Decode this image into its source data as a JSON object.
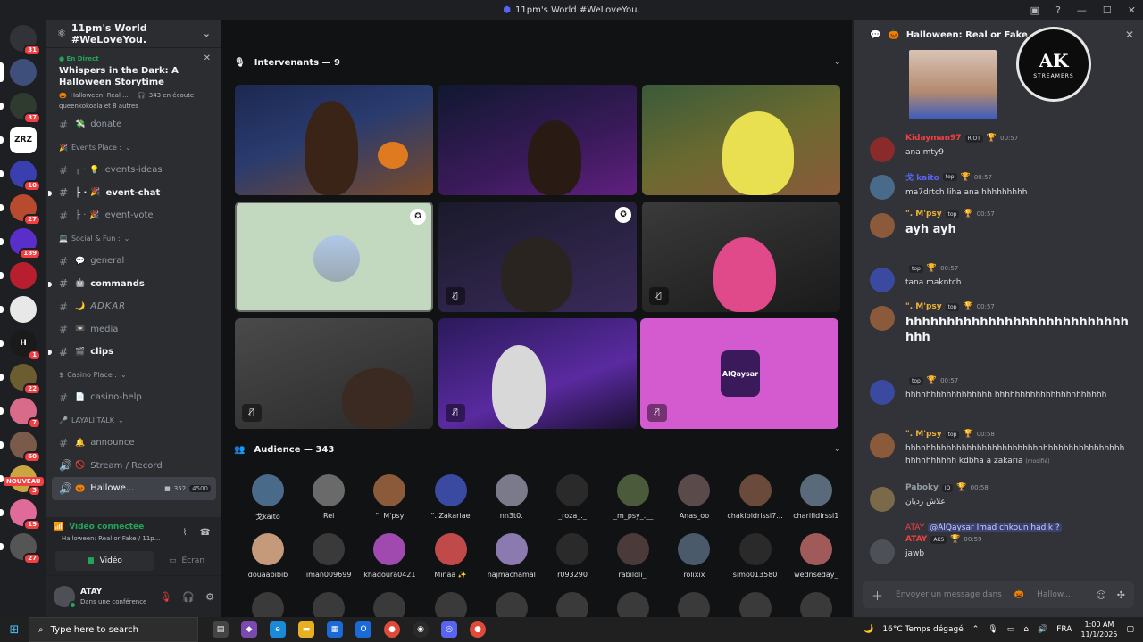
{
  "window": {
    "title": "11pm's World #WeLoveYou."
  },
  "colors": {
    "accent": "#5865f2",
    "online": "#23a55a",
    "danger": "#f23f43",
    "bg": "#1e1f22"
  },
  "guilds": [
    {
      "label": "",
      "badge": "31",
      "color": "#313338",
      "icon": "discord-icon"
    },
    {
      "label": "",
      "badge": "",
      "color": "#3d4f7a",
      "active": true
    },
    {
      "label": "",
      "badge": "37",
      "color": "#2f3b2f"
    },
    {
      "label": "ZRZ",
      "badge": "",
      "color": "#ffffff"
    },
    {
      "label": "",
      "badge": "10",
      "color": "#3a3fb0"
    },
    {
      "label": "",
      "badge": "27",
      "color": "#b84a2e"
    },
    {
      "label": "",
      "badge": "189",
      "color": "#5a2ec9"
    },
    {
      "label": "",
      "badge": "",
      "color": "#b81f2e"
    },
    {
      "label": "",
      "badge": "",
      "color": "#e8e8e8"
    },
    {
      "label": "H",
      "badge": "1",
      "color": "#1a1a1a"
    },
    {
      "label": "",
      "badge": "22",
      "color": "#6b5d30"
    },
    {
      "label": "",
      "badge": "7",
      "color": "#d96b8a"
    },
    {
      "label": "",
      "badge": "60",
      "color": "#7a5a4a"
    },
    {
      "label": "",
      "badge": "3",
      "color": "#c9a640"
    },
    {
      "label": "",
      "badge": "19",
      "color": "#e06a9a"
    },
    {
      "label": "",
      "badge": "27",
      "color": "#555555"
    }
  ],
  "nouveau": "NOUVEAU",
  "server": {
    "name": "11pm's World #WeLoveYou."
  },
  "live": {
    "tag": "En Direct",
    "title": "Whispers in the Dark: A Halloween Storytime",
    "stage": "Halloween: Real ...",
    "listeners": "343 en écoute",
    "hosts": "queenkokoala et 8 autres"
  },
  "channels": [
    {
      "type": "ch",
      "emoji": "💸",
      "name": "donate"
    },
    {
      "type": "cat",
      "emoji": "🎉",
      "name": "Events Place :"
    },
    {
      "type": "ch",
      "emoji": "💡",
      "name": "events-ideas",
      "prefix": "┌ ·"
    },
    {
      "type": "ch",
      "emoji": "🎉",
      "name": "event-chat",
      "prefix": "├ ·",
      "bright": true
    },
    {
      "type": "ch",
      "emoji": "🎉",
      "name": "event-vote",
      "prefix": "├ ·"
    },
    {
      "type": "cat",
      "emoji": "💻",
      "name": "Social & Fun :"
    },
    {
      "type": "ch",
      "emoji": "💬",
      "name": "general"
    },
    {
      "type": "ch",
      "emoji": "🤖",
      "name": "commands",
      "bright": true
    },
    {
      "type": "ch",
      "emoji": "🌙",
      "name": "ADKAR"
    },
    {
      "type": "ch",
      "emoji": "📼",
      "name": "media"
    },
    {
      "type": "ch",
      "emoji": "🎬",
      "name": "clips",
      "bright": true
    },
    {
      "type": "cat",
      "emoji": "$",
      "name": "Casino Place :"
    },
    {
      "type": "ch",
      "emoji": "📄",
      "name": "casino-help"
    },
    {
      "type": "cat",
      "emoji": "🎤",
      "name": "LAYALI TALK"
    },
    {
      "type": "ch",
      "emoji": "🔔",
      "name": "announce"
    },
    {
      "type": "ch",
      "emoji": "🚫",
      "name": "Stream / Record",
      "voice": true
    },
    {
      "type": "ch",
      "emoji": "🎃",
      "name": "Hallowe...",
      "voice": true,
      "active": true,
      "count1": "352",
      "count2": "4500"
    }
  ],
  "voice": {
    "status": "Vidéo connectée",
    "channel": "Halloween: Real or Fake / 11p...",
    "video_btn": "Vidéo",
    "screen_btn": "Écran"
  },
  "user": {
    "name": "ATAY",
    "sub": "Dans une conférence"
  },
  "stage": {
    "speakers_label": "Intervenants — 9",
    "audience_label": "Audience — 343",
    "tile_logo_text": "AlQaysar"
  },
  "audience": [
    {
      "name": "戈kaito",
      "color": "#4a6a8a"
    },
    {
      "name": "Rei",
      "color": "#6a6a6a"
    },
    {
      "name": "\". M'psy",
      "color": "#8a5a3a"
    },
    {
      "name": "\". Zakariae",
      "color": "#3a4aa0"
    },
    {
      "name": "nn3t0.",
      "color": "#7a7a8a"
    },
    {
      "name": "_roza_._",
      "color": "#2a2a2a"
    },
    {
      "name": "_m_psy_.__",
      "color": "#4a5a3a"
    },
    {
      "name": "Anas_oo",
      "color": "#5a4a4a"
    },
    {
      "name": "chakibidrissi7...",
      "color": "#6a4a3a"
    },
    {
      "name": "charifidirssi1",
      "color": "#5a6a7a"
    },
    {
      "name": "douaabibib",
      "color": "#c49a7a"
    },
    {
      "name": "iman009699",
      "color": "#3a3a3a"
    },
    {
      "name": "khadoura0421",
      "color": "#a04ab0"
    },
    {
      "name": "Minaa ✨",
      "color": "#c04a4a"
    },
    {
      "name": "najmachamal",
      "color": "#8a7ab0"
    },
    {
      "name": "r093290",
      "color": "#2a2a2a"
    },
    {
      "name": "rabiloli_.",
      "color": "#4a3a3a"
    },
    {
      "name": "rolixix",
      "color": "#4a5a6a"
    },
    {
      "name": "simo013580",
      "color": "#2a2a2a"
    },
    {
      "name": "wednseday_",
      "color": "#a05a5a"
    }
  ],
  "chat": {
    "title": "Halloween: Real or Fake",
    "logo_mark": "AK",
    "logo_sub": "STREAMERS",
    "messages": [
      {
        "name": "Kidayman97",
        "color": "#f23f43",
        "tag": "RIOT",
        "time": "00:57",
        "text": "ana mty9",
        "avatar": "#8a2a2a"
      },
      {
        "name": "戈 kaito",
        "color": "#5865f2",
        "tag": "top",
        "time": "00:57",
        "text": "ma7drtch liha ana hhhhhhhhh",
        "avatar": "#4a6a8a"
      },
      {
        "name": "\". M'psy",
        "color": "#f0b232",
        "tag": "top",
        "time": "00:57",
        "text": "ayh ayh",
        "big": true,
        "avatar": "#8a5a3a"
      },
      {
        "name": "",
        "color": "#f23f43",
        "tag": "top",
        "time": "00:57",
        "text": "tana makntch",
        "avatar": "#3a4aa0"
      },
      {
        "name": "\". M'psy",
        "color": "#f0b232",
        "tag": "top",
        "time": "00:57",
        "text": "hhhhhhhhhhhhhhhhhhhhhhhhhhh hhh",
        "big": true,
        "avatar": "#8a5a3a"
      },
      {
        "name": "",
        "color": "#f23f43",
        "tag": "top",
        "time": "00:57",
        "text": "hhhhhhhhhhhhhhhhh hhhhhhhhhhhhhhhhhhhhhh",
        "avatar": "#3a4aa0"
      },
      {
        "name": "\". M'psy",
        "color": "#f0b232",
        "tag": "top",
        "time": "00:58",
        "text": "hhhhhhhhhhhhhhhhhhhhhhhhhhhhhhhhhhhhhhhhhhh hhhhhhhhhh kdbha a zakaria",
        "edited": "(modifié)",
        "avatar": "#8a5a3a"
      },
      {
        "name": "Paboky",
        "color": "#949ba4",
        "tag": "IQ",
        "time": "00:58",
        "text": "علاش ردیان",
        "avatar": "#7a6a4a"
      },
      {
        "name": "ATAY",
        "color": "#f23f43",
        "tag": "AKS",
        "time": "00:59",
        "text": "jawb",
        "reply_to": "ATAY",
        "reply_text": "@AlQaysar Imad chkoun hadik ?",
        "avatar": "#4e5058"
      }
    ],
    "input_placeholder": "Envoyer un message dans",
    "input_channel": "Hallow..."
  },
  "taskbar": {
    "search": "Type here to search",
    "weather": "16°C  Temps dégagé",
    "lang": "FRA",
    "time": "1:00 AM",
    "date": "11/1/2025"
  }
}
